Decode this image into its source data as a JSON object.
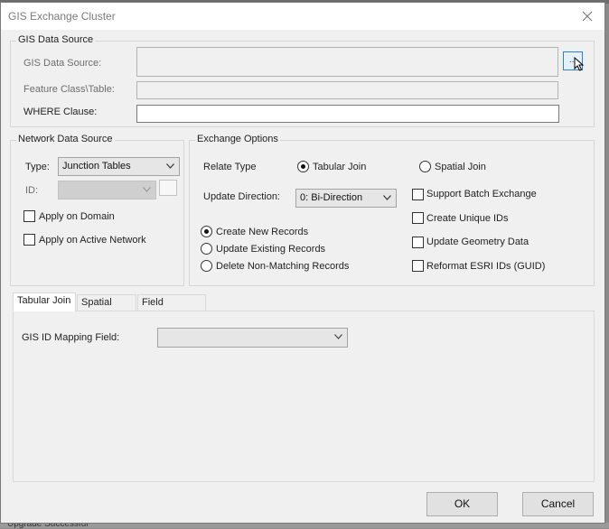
{
  "window": {
    "title": "GIS Exchange Cluster"
  },
  "gis_source": {
    "legend": "GIS Data Source",
    "data_source_label": "GIS Data Source:",
    "data_source_value": "",
    "browse_label": "...",
    "feature_class_label": "Feature Class\\Table:",
    "feature_class_value": "",
    "where_label": "WHERE Clause:",
    "where_value": ""
  },
  "network_source": {
    "legend": "Network Data Source",
    "type_label": "Type:",
    "type_value": "Junction Tables",
    "id_label": "ID:",
    "id_value": "",
    "apply_domain_label": "Apply on Domain",
    "apply_active_label": "Apply on Active Network"
  },
  "exchange": {
    "legend": "Exchange Options",
    "relate_label": "Relate Type",
    "tabular_join_label": "Tabular Join",
    "spatial_join_label": "Spatial Join",
    "update_dir_label": "Update Direction:",
    "update_dir_value": "0: Bi-Direction",
    "create_new_label": "Create New Records",
    "update_existing_label": "Update Existing Records",
    "delete_nonmatching_label": "Delete Non-Matching Records",
    "support_batch_label": "Support Batch Exchange",
    "create_unique_label": "Create Unique IDs",
    "update_geometry_label": "Update Geometry Data",
    "reformat_esri_label": "Reformat ESRI IDs (GUID)"
  },
  "tabs": [
    {
      "label": "Tabular Join"
    },
    {
      "label": "Spatial Join"
    },
    {
      "label": "Field Mapping"
    }
  ],
  "tab_content": {
    "gisid_label": "GIS ID Mapping Field:",
    "gisid_value": ""
  },
  "buttons": {
    "ok": "OK",
    "cancel": "Cancel"
  },
  "background": {
    "status_text": "Upgrade Successful"
  },
  "colors": {
    "focus_blue": "#2f7fd0",
    "dialog_bg": "#f0f0f0"
  }
}
